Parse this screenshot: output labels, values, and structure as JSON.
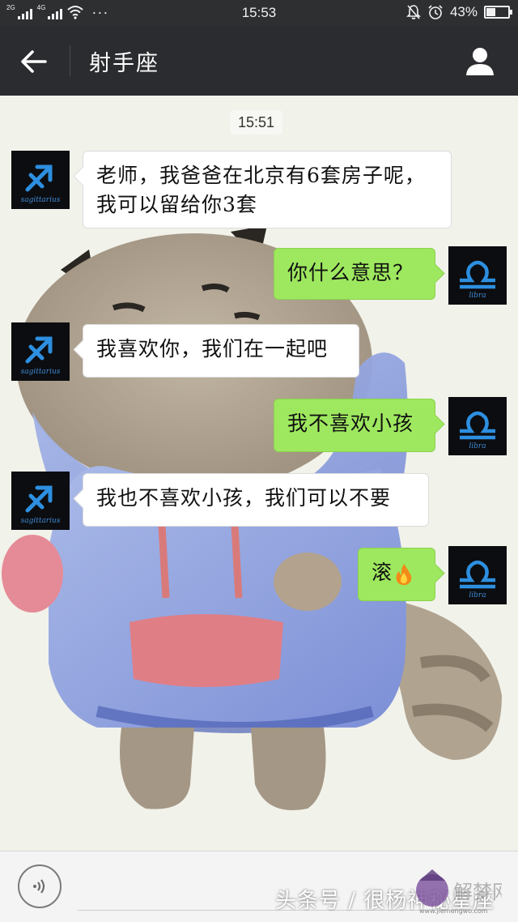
{
  "status_bar": {
    "sim1_label": "2G",
    "sim2_label": "4G",
    "more_dots": "···",
    "time": "15:53",
    "battery_percent_text": "43%",
    "battery_level": 0.43
  },
  "header": {
    "title": "射手座",
    "back_icon": "arrow-left-icon",
    "profile_icon": "person-icon"
  },
  "chat": {
    "timestamp": "15:51",
    "incoming_avatar_caption": "sagittarius",
    "outgoing_avatar_caption": "libra",
    "messages": [
      {
        "side": "in",
        "text": "老师，我爸爸在北京有6套房子呢，我可以留给你3套"
      },
      {
        "side": "out",
        "text": "你什么意思？"
      },
      {
        "side": "in",
        "text": "我喜欢你，我们在一起吧"
      },
      {
        "side": "out",
        "text": "我不喜欢小孩"
      },
      {
        "side": "in",
        "text": "我也不喜欢小孩，我们可以不要"
      },
      {
        "side": "out",
        "text": "滚",
        "emoji": "fire-icon"
      }
    ]
  },
  "input_bar": {
    "voice_icon": "voice-icon",
    "watermark_text": "头条号 / 很杨神秘星座",
    "watermark_logo": "解梦网",
    "watermark_url": "www.jiemengwo.com"
  },
  "colors": {
    "header_bg": "#2b2c30",
    "outgoing_bubble": "#9ee85f",
    "incoming_bubble": "#ffffff",
    "zodiac_blue": "#2d8fe0"
  }
}
